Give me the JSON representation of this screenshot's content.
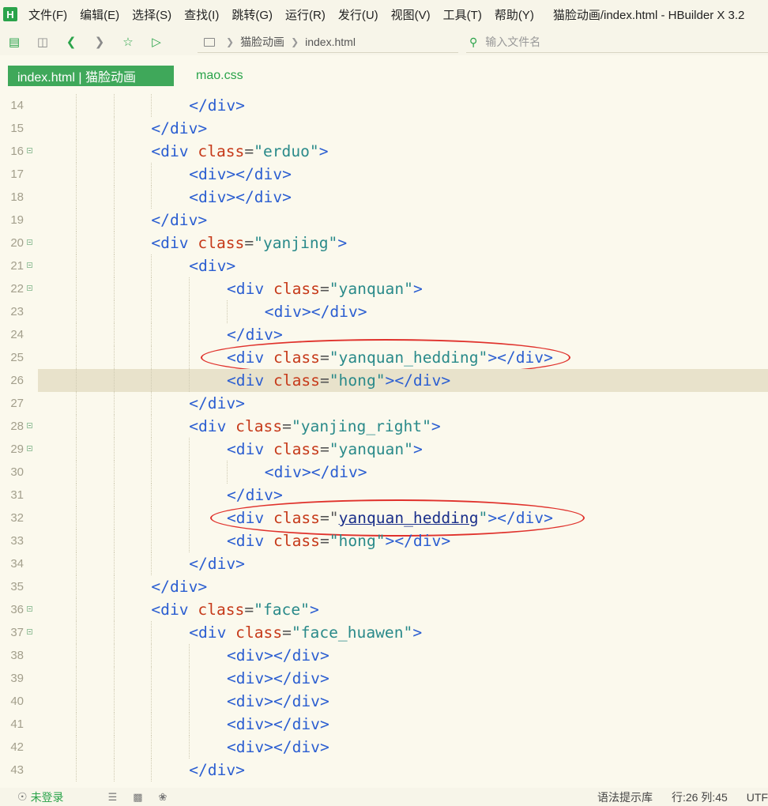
{
  "app": {
    "logo_letter": "H",
    "window_title": "猫脸动画/index.html - HBuilder X 3.2"
  },
  "menu": [
    "文件(F)",
    "编辑(E)",
    "选择(S)",
    "查找(I)",
    "跳转(G)",
    "运行(R)",
    "发行(U)",
    "视图(V)",
    "工具(T)",
    "帮助(Y)"
  ],
  "toolbar": {
    "icons": [
      "new-file-icon",
      "save-icon",
      "back-icon",
      "forward-icon",
      "star-icon",
      "run-icon"
    ],
    "breadcrumb": [
      "猫脸动画",
      "index.html"
    ],
    "file_search_placeholder": "输入文件名"
  },
  "tabs": [
    {
      "label": "index.html | 猫脸动画",
      "active": true
    },
    {
      "label": "mao.css",
      "active": false
    }
  ],
  "editor": {
    "current_line": 26,
    "lines": [
      {
        "n": "14",
        "indent": 4,
        "fold": false,
        "tokens": [
          [
            "tag",
            "</div>"
          ]
        ]
      },
      {
        "n": "15",
        "indent": 3,
        "fold": false,
        "tokens": [
          [
            "tag",
            "</div>"
          ]
        ]
      },
      {
        "n": "16",
        "indent": 3,
        "fold": true,
        "tokens": [
          [
            "tag",
            "<div "
          ],
          [
            "attr",
            "class"
          ],
          [
            "punc",
            "="
          ],
          [
            "str",
            "\"erduo\""
          ],
          [
            "tag",
            ">"
          ]
        ]
      },
      {
        "n": "17",
        "indent": 4,
        "fold": false,
        "tokens": [
          [
            "tag",
            "<div></div>"
          ]
        ]
      },
      {
        "n": "18",
        "indent": 4,
        "fold": false,
        "tokens": [
          [
            "tag",
            "<div></div>"
          ]
        ]
      },
      {
        "n": "19",
        "indent": 3,
        "fold": false,
        "tokens": [
          [
            "tag",
            "</div>"
          ]
        ]
      },
      {
        "n": "20",
        "indent": 3,
        "fold": true,
        "tokens": [
          [
            "tag",
            "<div "
          ],
          [
            "attr",
            "class"
          ],
          [
            "punc",
            "="
          ],
          [
            "str",
            "\"yanjing\""
          ],
          [
            "tag",
            ">"
          ]
        ]
      },
      {
        "n": "21",
        "indent": 4,
        "fold": true,
        "tokens": [
          [
            "tag",
            "<div>"
          ]
        ]
      },
      {
        "n": "22",
        "indent": 5,
        "fold": true,
        "tokens": [
          [
            "tag",
            "<div "
          ],
          [
            "attr",
            "class"
          ],
          [
            "punc",
            "="
          ],
          [
            "str",
            "\"yanquan\""
          ],
          [
            "tag",
            ">"
          ]
        ]
      },
      {
        "n": "23",
        "indent": 6,
        "fold": false,
        "tokens": [
          [
            "tag",
            "<div></div>"
          ]
        ]
      },
      {
        "n": "24",
        "indent": 5,
        "fold": false,
        "tokens": [
          [
            "tag",
            "</div>"
          ]
        ]
      },
      {
        "n": "25",
        "indent": 5,
        "fold": false,
        "tokens": [
          [
            "tag",
            "<div "
          ],
          [
            "attr",
            "class"
          ],
          [
            "punc",
            "="
          ],
          [
            "str",
            "\"yanquan_hedding\""
          ],
          [
            "tag",
            "></div>"
          ]
        ]
      },
      {
        "n": "26",
        "indent": 5,
        "fold": false,
        "tokens": [
          [
            "tag",
            "<div "
          ],
          [
            "attr",
            "class"
          ],
          [
            "punc",
            "="
          ],
          [
            "str",
            "\"hong\""
          ],
          [
            "tag",
            "></div>"
          ]
        ]
      },
      {
        "n": "27",
        "indent": 4,
        "fold": false,
        "tokens": [
          [
            "tag",
            "</div>"
          ]
        ]
      },
      {
        "n": "28",
        "indent": 4,
        "fold": true,
        "tokens": [
          [
            "tag",
            "<div "
          ],
          [
            "attr",
            "class"
          ],
          [
            "punc",
            "="
          ],
          [
            "str",
            "\"yanjing_right\""
          ],
          [
            "tag",
            ">"
          ]
        ]
      },
      {
        "n": "29",
        "indent": 5,
        "fold": true,
        "tokens": [
          [
            "tag",
            "<div "
          ],
          [
            "attr",
            "class"
          ],
          [
            "punc",
            "="
          ],
          [
            "str",
            "\"yanquan\""
          ],
          [
            "tag",
            ">"
          ]
        ]
      },
      {
        "n": "30",
        "indent": 6,
        "fold": false,
        "tokens": [
          [
            "tag",
            "<div></div>"
          ]
        ]
      },
      {
        "n": "31",
        "indent": 5,
        "fold": false,
        "tokens": [
          [
            "tag",
            "</div>"
          ]
        ]
      },
      {
        "n": "32",
        "indent": 5,
        "fold": false,
        "tokens": [
          [
            "tag",
            "<div "
          ],
          [
            "attr",
            "class"
          ],
          [
            "punc",
            "=\""
          ],
          [
            "under",
            "yanquan_hedding"
          ],
          [
            "str",
            "\""
          ],
          [
            "tag",
            "></div>"
          ]
        ]
      },
      {
        "n": "33",
        "indent": 5,
        "fold": false,
        "tokens": [
          [
            "tag",
            "<div "
          ],
          [
            "attr",
            "class"
          ],
          [
            "punc",
            "="
          ],
          [
            "str",
            "\"hong\""
          ],
          [
            "tag",
            "></div>"
          ]
        ]
      },
      {
        "n": "34",
        "indent": 4,
        "fold": false,
        "tokens": [
          [
            "tag",
            "</div>"
          ]
        ]
      },
      {
        "n": "35",
        "indent": 3,
        "fold": false,
        "tokens": [
          [
            "tag",
            "</div>"
          ]
        ]
      },
      {
        "n": "36",
        "indent": 3,
        "fold": true,
        "tokens": [
          [
            "tag",
            "<div "
          ],
          [
            "attr",
            "class"
          ],
          [
            "punc",
            "="
          ],
          [
            "str",
            "\"face\""
          ],
          [
            "tag",
            ">"
          ]
        ]
      },
      {
        "n": "37",
        "indent": 4,
        "fold": true,
        "tokens": [
          [
            "tag",
            "<div "
          ],
          [
            "attr",
            "class"
          ],
          [
            "punc",
            "="
          ],
          [
            "str",
            "\"face_huawen\""
          ],
          [
            "tag",
            ">"
          ]
        ]
      },
      {
        "n": "38",
        "indent": 5,
        "fold": false,
        "tokens": [
          [
            "tag",
            "<div></div>"
          ]
        ]
      },
      {
        "n": "39",
        "indent": 5,
        "fold": false,
        "tokens": [
          [
            "tag",
            "<div></div>"
          ]
        ]
      },
      {
        "n": "40",
        "indent": 5,
        "fold": false,
        "tokens": [
          [
            "tag",
            "<div></div>"
          ]
        ]
      },
      {
        "n": "41",
        "indent": 5,
        "fold": false,
        "tokens": [
          [
            "tag",
            "<div></div>"
          ]
        ]
      },
      {
        "n": "42",
        "indent": 5,
        "fold": false,
        "tokens": [
          [
            "tag",
            "<div></div>"
          ]
        ]
      },
      {
        "n": "43",
        "indent": 4,
        "fold": false,
        "tokens": [
          [
            "tag",
            "</div>"
          ]
        ]
      }
    ]
  },
  "status": {
    "login": "未登录",
    "hint_lib": "语法提示库",
    "position": "行:26  列:45",
    "encoding": "UTF"
  },
  "colors": {
    "accent": "#2aa34a",
    "annotation": "#e0322c",
    "highlight_line": "#e8e2cb"
  }
}
